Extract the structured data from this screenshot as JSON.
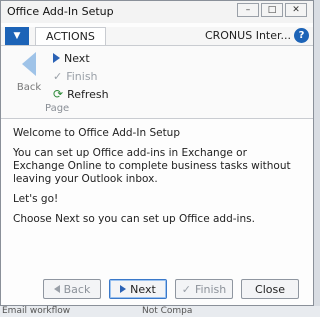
{
  "window": {
    "title": "Office Add-In Setup"
  },
  "ribbon": {
    "tab_label": "ACTIONS",
    "company": "CRONUS Inter...",
    "help": "?",
    "back_label": "Back",
    "next_label": "Next",
    "finish_label": "Finish",
    "refresh_label": "Refresh",
    "group_label": "Page"
  },
  "content": {
    "heading": "Welcome to Office Add-In Setup",
    "description": "You can set up Office add-ins in Exchange or Exchange Online to complete business tasks without leaving your Outlook inbox.",
    "lets_go": "Let's go!",
    "instruction": "Choose Next so you can set up Office add-ins."
  },
  "footer": {
    "back": "Back",
    "next": "Next",
    "finish": "Finish",
    "close": "Close"
  },
  "background": {
    "left_text": "Email workflow",
    "right_text": "Not Compa"
  },
  "colors": {
    "accent": "#1c63b7",
    "ribbon_icon_blue": "#2b62b5",
    "refresh_green": "#2f8a3a"
  }
}
